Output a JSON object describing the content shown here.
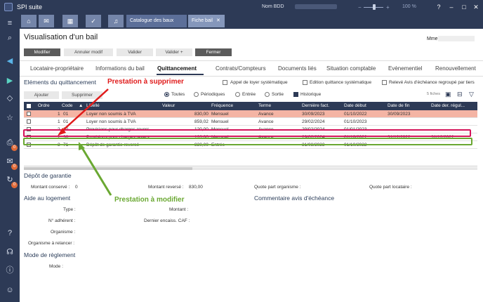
{
  "app": {
    "title": "SPI suite",
    "nom_bdd_label": "Nom BDD",
    "zoom": "100 %"
  },
  "tabs": {
    "catalogue": "Catalogue des baux",
    "fiche": "Fiche bail"
  },
  "sidebar_badges": [
    "0",
    "0",
    "0"
  ],
  "page": {
    "title": "Visualisation d'un bail",
    "mme_label": "Mme"
  },
  "toolbar": {
    "modifier": "Modifier",
    "annuler": "Annuler modif",
    "valider": "Valider",
    "valider_plus": "Valider +",
    "fermer": "Fermer"
  },
  "nav_tabs": [
    "Locataire-propriétaire",
    "Informations du bail",
    "Quittancement",
    "Contrats/Compteurs",
    "Documents liés",
    "Situation comptable",
    "Evènementiel",
    "Renouvellement"
  ],
  "quittancement": {
    "section_title": "Eléments du quittancement",
    "options": {
      "appel": "Appel de loyer systématique",
      "edition": "Edition quittance systématique",
      "releve": "Relevé Avis d'échéance regroupé par tiers"
    },
    "add_button": "Ajouter",
    "delete_button": "Supprimer",
    "filters": {
      "toutes": "Toutes",
      "periodiques": "Périodiques",
      "entree": "Entrée",
      "sortie": "Sortie",
      "historique": "Historique"
    },
    "count": "5 fiches",
    "columns": [
      "Ordre",
      "Code",
      "Libellé",
      "Valeur",
      "Fréquence",
      "Terme",
      "Dernière fact.",
      "Date début",
      "Date de fin",
      "Date der. régul..."
    ],
    "rows": [
      {
        "ordre": "1",
        "code": "01",
        "libelle": "Loyer non soumis à TVA",
        "valeur": "830,00",
        "frequence": "Mensuel",
        "terme": "Avance",
        "derniere": "30/09/2023",
        "debut": "01/10/2022",
        "fin": "30/09/2023",
        "regul": ""
      },
      {
        "ordre": "1",
        "code": "01",
        "libelle": "Loyer non soumis à TVA",
        "valeur": "859,02",
        "frequence": "Mensuel",
        "terme": "Avance",
        "derniere": "29/02/2024",
        "debut": "01/10/2023",
        "fin": "",
        "regul": ""
      },
      {
        "ordre": "2",
        "code": "30",
        "libelle": "Provisions pour charges revers...",
        "valeur": "120,00",
        "frequence": "Mensuel",
        "terme": "Avance",
        "derniere": "29/02/2024",
        "debut": "01/01/2023",
        "fin": "",
        "regul": ""
      },
      {
        "ordre": "2",
        "code": "30",
        "libelle": "Provisions pour charges revers...",
        "valeur": "120,00",
        "frequence": "Mensuel",
        "terme": "Avance",
        "derniere": "29/02/2024",
        "debut": "01/10/2022",
        "fin": "31/12/2022",
        "regul": "31/12/2022"
      },
      {
        "ordre": "3",
        "code": "71",
        "libelle": "Dépôt de garantie reversé",
        "valeur": "830,00",
        "frequence": "Entrée",
        "terme": "",
        "derniere": "31/08/2023",
        "debut": "01/10/2022",
        "fin": "",
        "regul": ""
      }
    ]
  },
  "depot": {
    "title": "Dépôt de garantie",
    "conserve_label": "Montant conservé :",
    "conserve_value": "0",
    "reverse_label": "Montant reversé :",
    "reverse_value": "830,00",
    "quote_org": "Quote part organisme :",
    "quote_loc": "Quote part locataire :"
  },
  "aide": {
    "title": "Aide au logement",
    "type": "Type :",
    "adherent": "N° adhérent :",
    "organisme": "Organisme :",
    "organisme_relancer": "Organisme à relancer :",
    "montant": "Montant :",
    "dernier": "Dernier encaiss. CAF :"
  },
  "commentaire": {
    "title": "Commentaire avis d'échéance"
  },
  "reglement": {
    "title": "Mode de règlement",
    "mode": "Mode :"
  },
  "annotations": {
    "supprimer": "Prestation à supprimer",
    "modifier": "Prestation à modifier"
  },
  "colors": {
    "delete": "#e01b1b",
    "modify": "#6aa832",
    "frame_red": "#d4145a",
    "highlight_row": "#f4b4a4"
  }
}
